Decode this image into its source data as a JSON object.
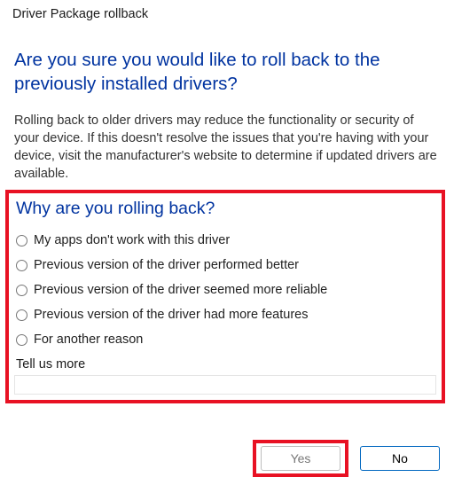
{
  "window": {
    "title": "Driver Package rollback"
  },
  "main": {
    "heading": "Are you sure you would like to roll back to the previously installed drivers?",
    "warning": "Rolling back to older drivers may reduce the functionality or security of your device. If this doesn't resolve the issues that you're having with your device, visit the manufacturer's website to determine if updated drivers are available."
  },
  "survey": {
    "heading": "Why are you rolling back?",
    "options": [
      "My apps don't work with this driver",
      "Previous version of the driver performed better",
      "Previous version of the driver seemed more reliable",
      "Previous version of the driver had more features",
      "For another reason"
    ],
    "tell_more_label": "Tell us more",
    "tell_more_value": ""
  },
  "buttons": {
    "yes": "Yes",
    "no": "No"
  },
  "highlight_color": "#e81123",
  "accent_color": "#0033a0"
}
